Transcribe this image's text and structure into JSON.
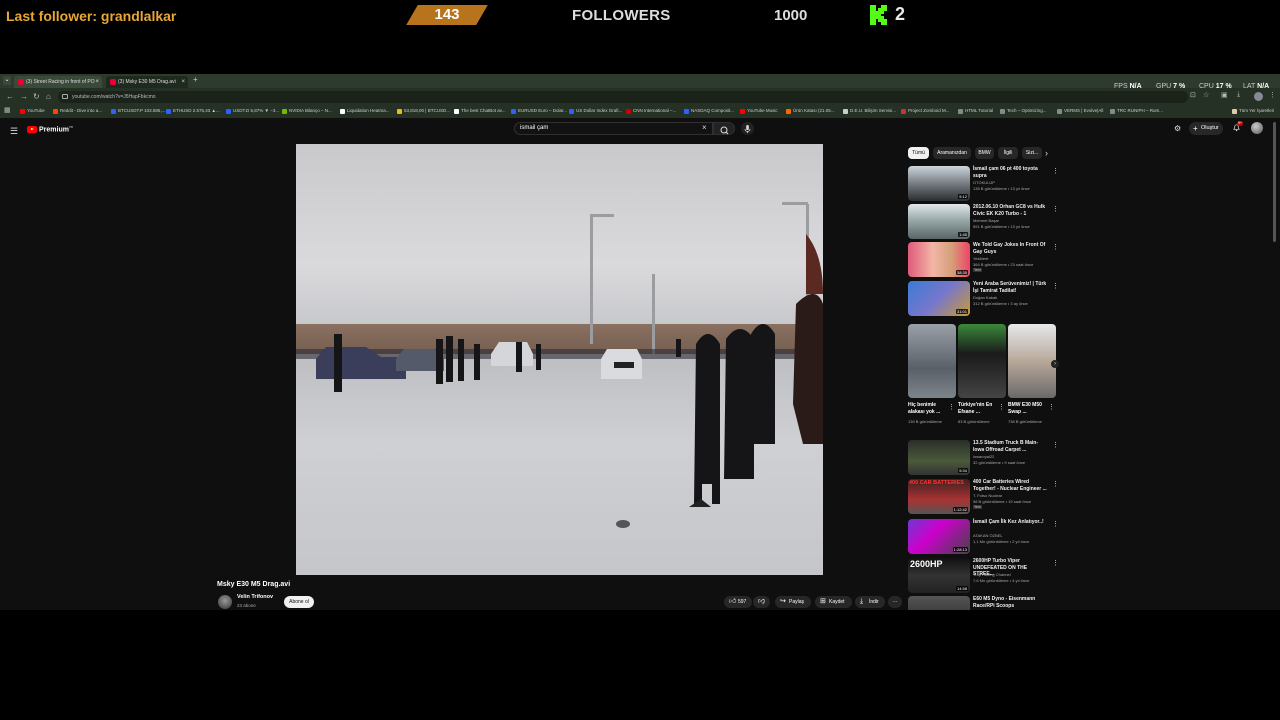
{
  "overlay": {
    "last_follower": "Last follower: grandlalkar",
    "followers_count": "143",
    "followers_label": "FOLLOWERS",
    "followers_goal": "1000",
    "kick_count": "2",
    "accent": "#e8a735",
    "kick_color": "#53fc18"
  },
  "browser": {
    "tabs": [
      {
        "label": "(3) Street Racing in front of PO"
      },
      {
        "label": "(3) Msky E30 M5 Drag.avi"
      }
    ],
    "new_tab": "+",
    "perf": {
      "fps_label": "FPS",
      "fps_value": "N/A",
      "gpu_label": "GPU",
      "gpu_value": "7 %",
      "cpu_label": "CPU",
      "cpu_value": "17 %",
      "lat_label": "LAT",
      "lat_value": "N/A"
    },
    "url": "youtube.com/watch?v=J5HapFbkcmo",
    "bookmarks": [
      "YouTube",
      "Reddit - Dive into a...",
      "BTCUSDT.P 103.585,...",
      "ETHUSD 2.575,43 ▲...",
      "USDT.D 5,87% ▼ −3...",
      "NVIDIA Bilanço – N...",
      "Liquidation Heatma...",
      "53,818,00 | BTCUSD...",
      "The best ChatBot av...",
      "EURUSD Euro – Dolar...",
      "US Dollar Index Grafi...",
      "CNN International –...",
      "NASDAQ Composit...",
      "YouTube Music",
      "Ürün Katası (21.05...",
      "D.E.U. Bilişim Servisi...",
      "Project Zomboid M...",
      "HTML Tutorial",
      "Tech – Optimizing...",
      "VERMS | Evolve|All",
      "TRC RUNIPH – Rum...",
      "Tüm Yer İşaretleri"
    ]
  },
  "youtube": {
    "brand": "Premium",
    "brand_sup": "TR",
    "search_value": "ismail çam",
    "create_label": "Oluştur",
    "notif_count": "9+",
    "video": {
      "title": "Msky E30 M5 Drag.avi",
      "channel": "Velin Trifonov",
      "subs": "23 abone",
      "subscribe": "Abone ol",
      "likes": "597",
      "share": "Paylaş",
      "save": "Kaydet",
      "download": "İndir",
      "more": "···"
    },
    "chips": [
      "Tümü",
      "Aramanızdan",
      "BMW",
      "İlgili",
      "Sizi..."
    ],
    "recs": [
      {
        "title": "İsmail çam 06 pt 400 toyota supra",
        "channel": "OTOKULÜP",
        "meta": "135 B görüntüleme • 13 yıl önce",
        "dur": "5:12"
      },
      {
        "title": "2012.06.10 Orhan GC8 vs Hulk Civic EK K20 Turbo - 1",
        "channel": "Mehmet Başar",
        "meta": "591 B görüntüleme • 13 yıl önce",
        "dur": "1:45"
      },
      {
        "title": "We Told Gay Jokes In Front Of Gay Guys",
        "channel": "YesMeet",
        "meta": "364 B görüntüleme • 23 saat önce",
        "dur": "38:35",
        "badge": "Yeni"
      },
      {
        "title": "Yeni Araba Serüvenimiz! | Türk İşi Tamirat Tadilat!",
        "channel": "Doğan Kabak",
        "meta": "312 B görüntüleme • 3 ay önce",
        "dur": "31:01"
      }
    ],
    "shorts": [
      {
        "title": "Hiç benimle alakası yok ...",
        "views": "139 B görüntüleme"
      },
      {
        "title": "Türkiye'nin En Efsane ...",
        "views": "83 B görüntüleme"
      },
      {
        "title": "BMW E30 M50 Swap ...",
        "views": "738 B görüntüleme"
      }
    ],
    "recs2": [
      {
        "title": "13.5 Stadium Truck B Main- Iowa Offroad Carpet ...",
        "channel": "iowaroyal22",
        "meta": "32 görüntüleme • 9 saat önce",
        "dur": "5:34"
      },
      {
        "title": "400 Car Batteries Wired Together! - Nuclear Engineer ...",
        "channel": "T. Fotso Nuclear",
        "meta": "98 B görüntüleme • 19 saat önce",
        "dur": "1:12:42",
        "badge": "Yeni",
        "thumb_text": "400 CAR BATTERIES"
      },
      {
        "title": "İsmail Çam İlk Kez Anlatıyor..!",
        "channel": "ATAKAN ÖZBEL",
        "meta": "1,1 Mn görüntüleme • 2 yıl önce",
        "dur": "1:28:13"
      },
      {
        "title": "2600HP Turbo Viper UNDEFEATED ON THE STREE...",
        "channel": "Trap Racing Channel",
        "meta": "7,6 Mn görüntüleme • 4 yıl önce",
        "dur": "14:58",
        "thumb_text": "2600HP"
      },
      {
        "title": "E60 M5 Dyno - Eisenmann Race/RPi Scoops",
        "channel": "",
        "meta": "",
        "dur": ""
      }
    ]
  }
}
